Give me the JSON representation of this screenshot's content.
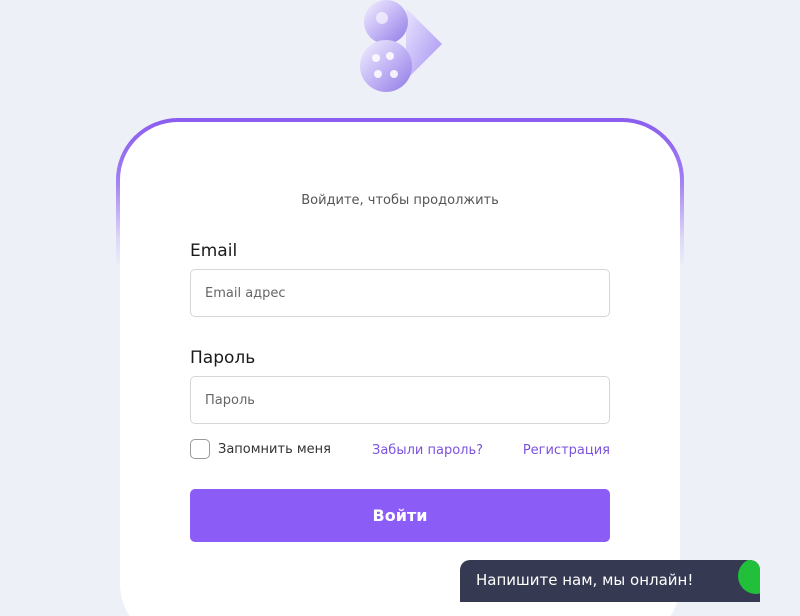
{
  "subtitle": "Войдите, чтобы продолжить",
  "form": {
    "email_label": "Email",
    "email_value": "",
    "email_placeholder": "Email адрес",
    "password_label": "Пароль",
    "password_value": "",
    "password_placeholder": "Пароль",
    "remember_label": "Запомнить меня",
    "remember_checked": false,
    "forgot_link": "Забыли пароль?",
    "register_link": "Регистрация",
    "submit_label": "Войти"
  },
  "chat": {
    "text": "Напишите нам, мы онлайн!",
    "status_icon": "online-status-icon"
  },
  "colors": {
    "accent": "#8b5cf6",
    "link": "#7b52e0",
    "background": "#eef0f7",
    "chat_background": "#353a52",
    "online": "#22c03a"
  }
}
